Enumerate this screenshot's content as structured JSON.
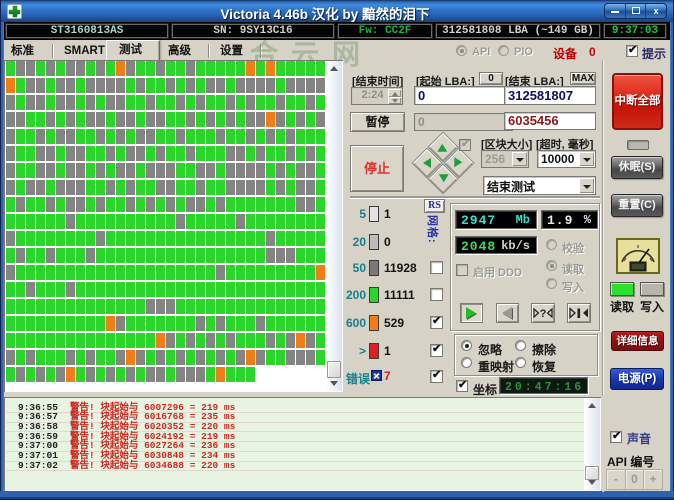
{
  "window": {
    "title": "Victoria 4.46b 汉化 by 黯然的泪下",
    "controls": {
      "minimize": "—",
      "maximize": "❐",
      "close": "✕"
    }
  },
  "statusbar": {
    "model": "ST3160813AS",
    "serial": "SN: 9SY13C16",
    "firmware": "Fw: CC2F",
    "capacity": "312581808 LBA (~149 GB)",
    "time": "9:37:03"
  },
  "tabs": [
    {
      "label": "标准",
      "active": false
    },
    {
      "label": "SMART",
      "active": false
    },
    {
      "label": "测试",
      "active": true
    },
    {
      "label": "高级",
      "active": false
    },
    {
      "label": "设置",
      "active": false
    }
  ],
  "tabrow": {
    "api_label": "API",
    "pio_label": "PIO",
    "api_selected": true,
    "device_label": "设备",
    "device_number": "0",
    "hint_label": "提示",
    "hint_checked": true,
    "watermark": "合云网"
  },
  "scan": {
    "end_time_label": "[结束时间]",
    "end_time_value": "2:24",
    "start_lba_label": "[起始 LBA:]",
    "start_lba_zero_btn": "0",
    "start_lba_value": "0",
    "start_lba_shadow": "0",
    "end_lba_label": "[结束 LBA:]",
    "max_btn": "MAX",
    "end_lba_value": "312581807",
    "current_lba_value": "6035456",
    "pause_btn": "暂停",
    "stop_btn": "停止",
    "block_size_label": "[区块大小]",
    "block_size_value": "256",
    "timeout_label": "[超时, 毫秒]",
    "timeout_value": "10000",
    "end_action_value": "结束测试",
    "rs_btn": "RS",
    "grid_vlabel": "网格:"
  },
  "legend": {
    "rows": [
      {
        "label": "5",
        "color": "#e2e2e2",
        "count": "1"
      },
      {
        "label": "20",
        "color": "#bcbcbc",
        "count": "0"
      },
      {
        "label": "50",
        "color": "#787878",
        "count": "11928"
      },
      {
        "label": "200",
        "color": "#2bd52b",
        "count": "11111"
      },
      {
        "label": "600",
        "color": "#f07d18",
        "count": "529"
      },
      {
        "label": ">",
        "color": "#e02020",
        "count": "1"
      }
    ],
    "error_label": "错误",
    "error_count": "7",
    "checkboxes": [
      false,
      false,
      true,
      true,
      true
    ]
  },
  "lcds": {
    "remain_value": "2947",
    "remain_unit": "Mb",
    "percent_value": "1.9",
    "percent_unit": "%",
    "speed_value": "2048",
    "speed_unit": "kb/s",
    "clock_value": "20:47:16"
  },
  "options": {
    "ddd_label": "启用 DDD",
    "ddd_checked": false,
    "mode_radios": [
      {
        "label": "校验",
        "selected": false
      },
      {
        "label": "读取",
        "selected": true
      },
      {
        "label": "写入",
        "selected": false
      }
    ],
    "action_radios": [
      {
        "label": "忽略",
        "selected": true
      },
      {
        "label": "擦除",
        "selected": false
      },
      {
        "label": "重映射",
        "selected": false
      },
      {
        "label": "恢复",
        "selected": false
      }
    ],
    "coord_label": "坐标",
    "coord_checked": true,
    "play_icons": {
      "scan": "green-play-icon",
      "back": "gray-back-icon",
      "jump": "jump-question-icon",
      "seek": "seek-end-icon"
    }
  },
  "rightcol": {
    "interrupt_btn": "中断全部",
    "sleep_btn": "休眠(S)",
    "reset_btn": "重置(C)",
    "read_label": "读取",
    "write_label": "写入",
    "read_color": "#2ee02e",
    "write_color": "#b6b6ae",
    "details_btn": "详细信息",
    "power_btn": "电源(P)"
  },
  "bottombar": {
    "sound_label": "声音",
    "sound_checked": true,
    "api_num_label": "API 编号",
    "stepper": [
      "-",
      "0",
      "+"
    ]
  },
  "log": {
    "rows": [
      {
        "time": "9:36:55",
        "msg": "警告! 块起始与 6007296 = 219 ms"
      },
      {
        "time": "9:36:57",
        "msg": "警告! 块起始与 6016768 = 235 ms"
      },
      {
        "time": "9:36:58",
        "msg": "警告! 块起始与 6020352 = 220 ms"
      },
      {
        "time": "9:36:59",
        "msg": "警告! 块起始与 6024192 = 219 ms"
      },
      {
        "time": "9:37:00",
        "msg": "警告! 块起始与 6027264 = 236 ms"
      },
      {
        "time": "9:37:01",
        "msg": "警告! 块起始与 6030848 = 234 ms"
      },
      {
        "time": "9:37:02",
        "msg": "警告! 块起始与 6034688 = 220 ms"
      }
    ]
  },
  "chart_data": {
    "type": "heatmap",
    "description": "HDD surface scan block map; g=green(<200ms), d=gray(<50ms shade), o=orange(<600ms)",
    "cell_colors": {
      "g": "#2bd52b",
      "d": "#848484",
      "o": "#f07d18",
      "r": "#e02020"
    },
    "rows": [
      "gddgdgddgdgodggdggdgggggogoggggg",
      "ogddgddgddddgdggdgdgddgddddgdddd",
      "dgddgddgdgddggdggdgdggdgdggdggdg",
      "ddggdgdgddgddgddggdgdgdgddodgdgd",
      "dggdgddggdgdgddggdgggdggdgdgdggg",
      "dggddgddggdgddgdggdgggddgdggdgdg",
      "dggddgddgdgddgdddggddgddddgdgddg",
      "dgddgdddggdgdggddggdggddddgdgddg",
      "gdggdgddgdggdgdgdgddgdgggggggddg",
      "ggggggdggggggggggdgggggdgggggggg",
      "dggggggggdggggggggggggggggdggggg",
      "gdggdgggdgggggggggggggggggdddggg",
      "dggggggggggggggggggggdgggggggggo",
      "ggdgggdggggggggggggggggggggggggg",
      "ggggggggggggggdddggggggggggggggg",
      "ggggggggggodgggggggdgdgggdgggggg",
      "gggggggggggggggodgdgdgdgggdgdodg",
      "dgdgggdgdggdodgdgdgdgdgdodggdddg",
      "gdgdgdogdgdgdgddgdddgoggg"
    ]
  }
}
